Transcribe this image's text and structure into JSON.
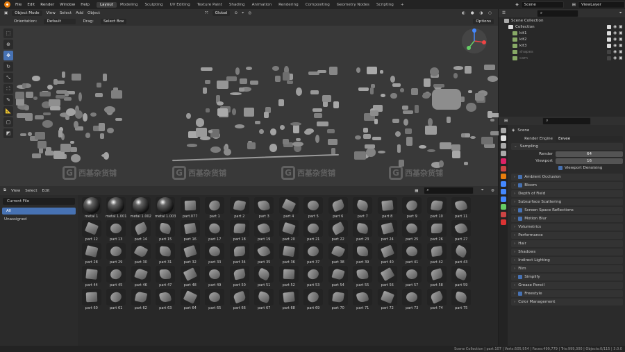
{
  "menu": {
    "items": [
      "File",
      "Edit",
      "Render",
      "Window",
      "Help"
    ]
  },
  "workspaces": [
    "Layout",
    "Modeling",
    "Sculpting",
    "UV Editing",
    "Texture Paint",
    "Shading",
    "Animation",
    "Rendering",
    "Compositing",
    "Geometry Nodes",
    "Scripting",
    "+"
  ],
  "top_right": {
    "scene": "Scene",
    "view_layer": "ViewLayer"
  },
  "viewport": {
    "mode": "Object Mode",
    "view_menu": [
      "View",
      "Select",
      "Add",
      "Object"
    ],
    "transform": "Global",
    "orientation_label": "Orientation:",
    "orientation_value": "Default",
    "drag_label": "Drag:",
    "drag_value": "Select Box",
    "options": "Options"
  },
  "watermark": "西基杂货铺",
  "asset_browser": {
    "menus": [
      "View",
      "Select",
      "Edit"
    ],
    "library": "Current File",
    "categories": [
      "All",
      "Unassigned"
    ],
    "assets": [
      "metal 1",
      "metal 1.001",
      "metal 1.002",
      "metal 1.003",
      "part.077",
      "part 1",
      "part 2",
      "part 3",
      "part 4",
      "part 5",
      "part 6",
      "part 7",
      "part 8",
      "part 9",
      "part 10",
      "part 11",
      "part 12",
      "part 13",
      "part 14",
      "part 15",
      "part 16",
      "part 17",
      "part 18",
      "part 19",
      "part 20",
      "part 21",
      "part 22",
      "part 23",
      "part 24",
      "part 25",
      "part 26",
      "part 27",
      "part 28",
      "part 29",
      "part 30",
      "part 31",
      "part 32",
      "part 33",
      "part 34",
      "part 35",
      "part 36",
      "part 37",
      "part 38",
      "part 39",
      "part 40",
      "part 41",
      "part 42",
      "part 43",
      "part 44",
      "part 45",
      "part 46",
      "part 47",
      "part 48",
      "part 49",
      "part 50",
      "part 51",
      "part 52",
      "part 53",
      "part 54",
      "part 55",
      "part 56",
      "part 57",
      "part 58",
      "part 59",
      "part 60",
      "part 61",
      "part 62",
      "part 63",
      "part 64",
      "part 65",
      "part 66",
      "part 67",
      "part 68",
      "part 69",
      "part 70",
      "part 71",
      "part 72",
      "part 73",
      "part 74",
      "part 75"
    ]
  },
  "outliner": {
    "root": "Scene Collection",
    "rows": [
      {
        "name": "Collection",
        "color": "#cfcfcf",
        "checked": true
      },
      {
        "name": "kit1",
        "color": "#cfcfcf",
        "checked": true
      },
      {
        "name": "kit2",
        "color": "#cfcfcf",
        "checked": true
      },
      {
        "name": "kit3",
        "color": "#cfcfcf",
        "checked": true
      },
      {
        "name": "shapes",
        "color": "#777777",
        "checked": false
      },
      {
        "name": "cam",
        "color": "#777777",
        "checked": false
      }
    ]
  },
  "properties": {
    "scene": "Scene",
    "render_engine_label": "Render Engine",
    "render_engine": "Eevee",
    "sampling": "Sampling",
    "render_label": "Render",
    "render_value": "64",
    "viewport_label": "Viewport",
    "viewport_value": "16",
    "viewport_denoising": "Viewport Denoising",
    "sections": [
      {
        "name": "Ambient Occlusion",
        "cb": true
      },
      {
        "name": "Bloom",
        "cb": true
      },
      {
        "name": "Depth of Field",
        "cb": false
      },
      {
        "name": "Subsurface Scattering",
        "cb": false
      },
      {
        "name": "Screen Space Reflections",
        "cb": true
      },
      {
        "name": "Motion Blur",
        "cb": true
      },
      {
        "name": "Volumetrics",
        "cb": false
      },
      {
        "name": "Performance",
        "cb": false
      },
      {
        "name": "Hair",
        "cb": false
      },
      {
        "name": "Shadows",
        "cb": false
      },
      {
        "name": "Indirect Lighting",
        "cb": false
      },
      {
        "name": "Film",
        "cb": false
      },
      {
        "name": "Simplify",
        "cb": true
      },
      {
        "name": "Grease Pencil",
        "cb": false
      },
      {
        "name": "Freestyle",
        "cb": true
      },
      {
        "name": "Color Management",
        "cb": false
      }
    ]
  },
  "status_bar": "Scene Collection | part.107 | Verts:505,954 | Faces:499,779 | Tris:999,300 | Objects:0/115 | 3.0.0"
}
